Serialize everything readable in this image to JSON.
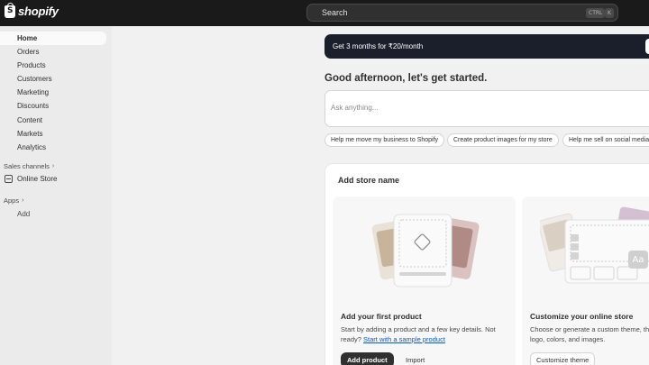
{
  "topbar": {
    "logo_text": "shopify",
    "search_label": "Search",
    "shortcut_ctrl": "CTRL",
    "shortcut_k": "K"
  },
  "sidebar": {
    "items": [
      {
        "label": "Home",
        "active": true
      },
      {
        "label": "Orders"
      },
      {
        "label": "Products"
      },
      {
        "label": "Customers"
      },
      {
        "label": "Marketing"
      },
      {
        "label": "Discounts"
      },
      {
        "label": "Content"
      },
      {
        "label": "Markets"
      },
      {
        "label": "Analytics"
      }
    ],
    "sales_channels_label": "Sales channels",
    "online_store_label": "Online Store",
    "apps_label": "Apps",
    "add_label": "Add"
  },
  "main": {
    "promo_text": "Get 3 months for ₹20/month",
    "greeting": "Good afternoon, let's get started.",
    "ask_placeholder": "Ask anything...",
    "chips": [
      "Help me move my business to Shopify",
      "Create product images for my store",
      "Help me sell on social media"
    ],
    "setup_card": {
      "title": "Add store name",
      "product": {
        "title": "Add your first product",
        "desc_prefix": "Start by adding a product and a few key details. Not ready?",
        "desc_link": "Start with a sample product",
        "primary_label": "Add product",
        "secondary_label": "Import"
      },
      "theme": {
        "title": "Customize your online store",
        "desc_line1": "Choose or generate a custom theme, th",
        "desc_line2": "logo, colors, and images.",
        "button_label": "Customize theme",
        "aa_label": "Aa"
      }
    }
  },
  "colors": {
    "topbar": "#1a1a1a",
    "sidebar": "#ebebeb",
    "page": "#f1f1f1",
    "promo": "#1a1f2b",
    "link": "#005bd3",
    "primary_button": "#303030"
  }
}
